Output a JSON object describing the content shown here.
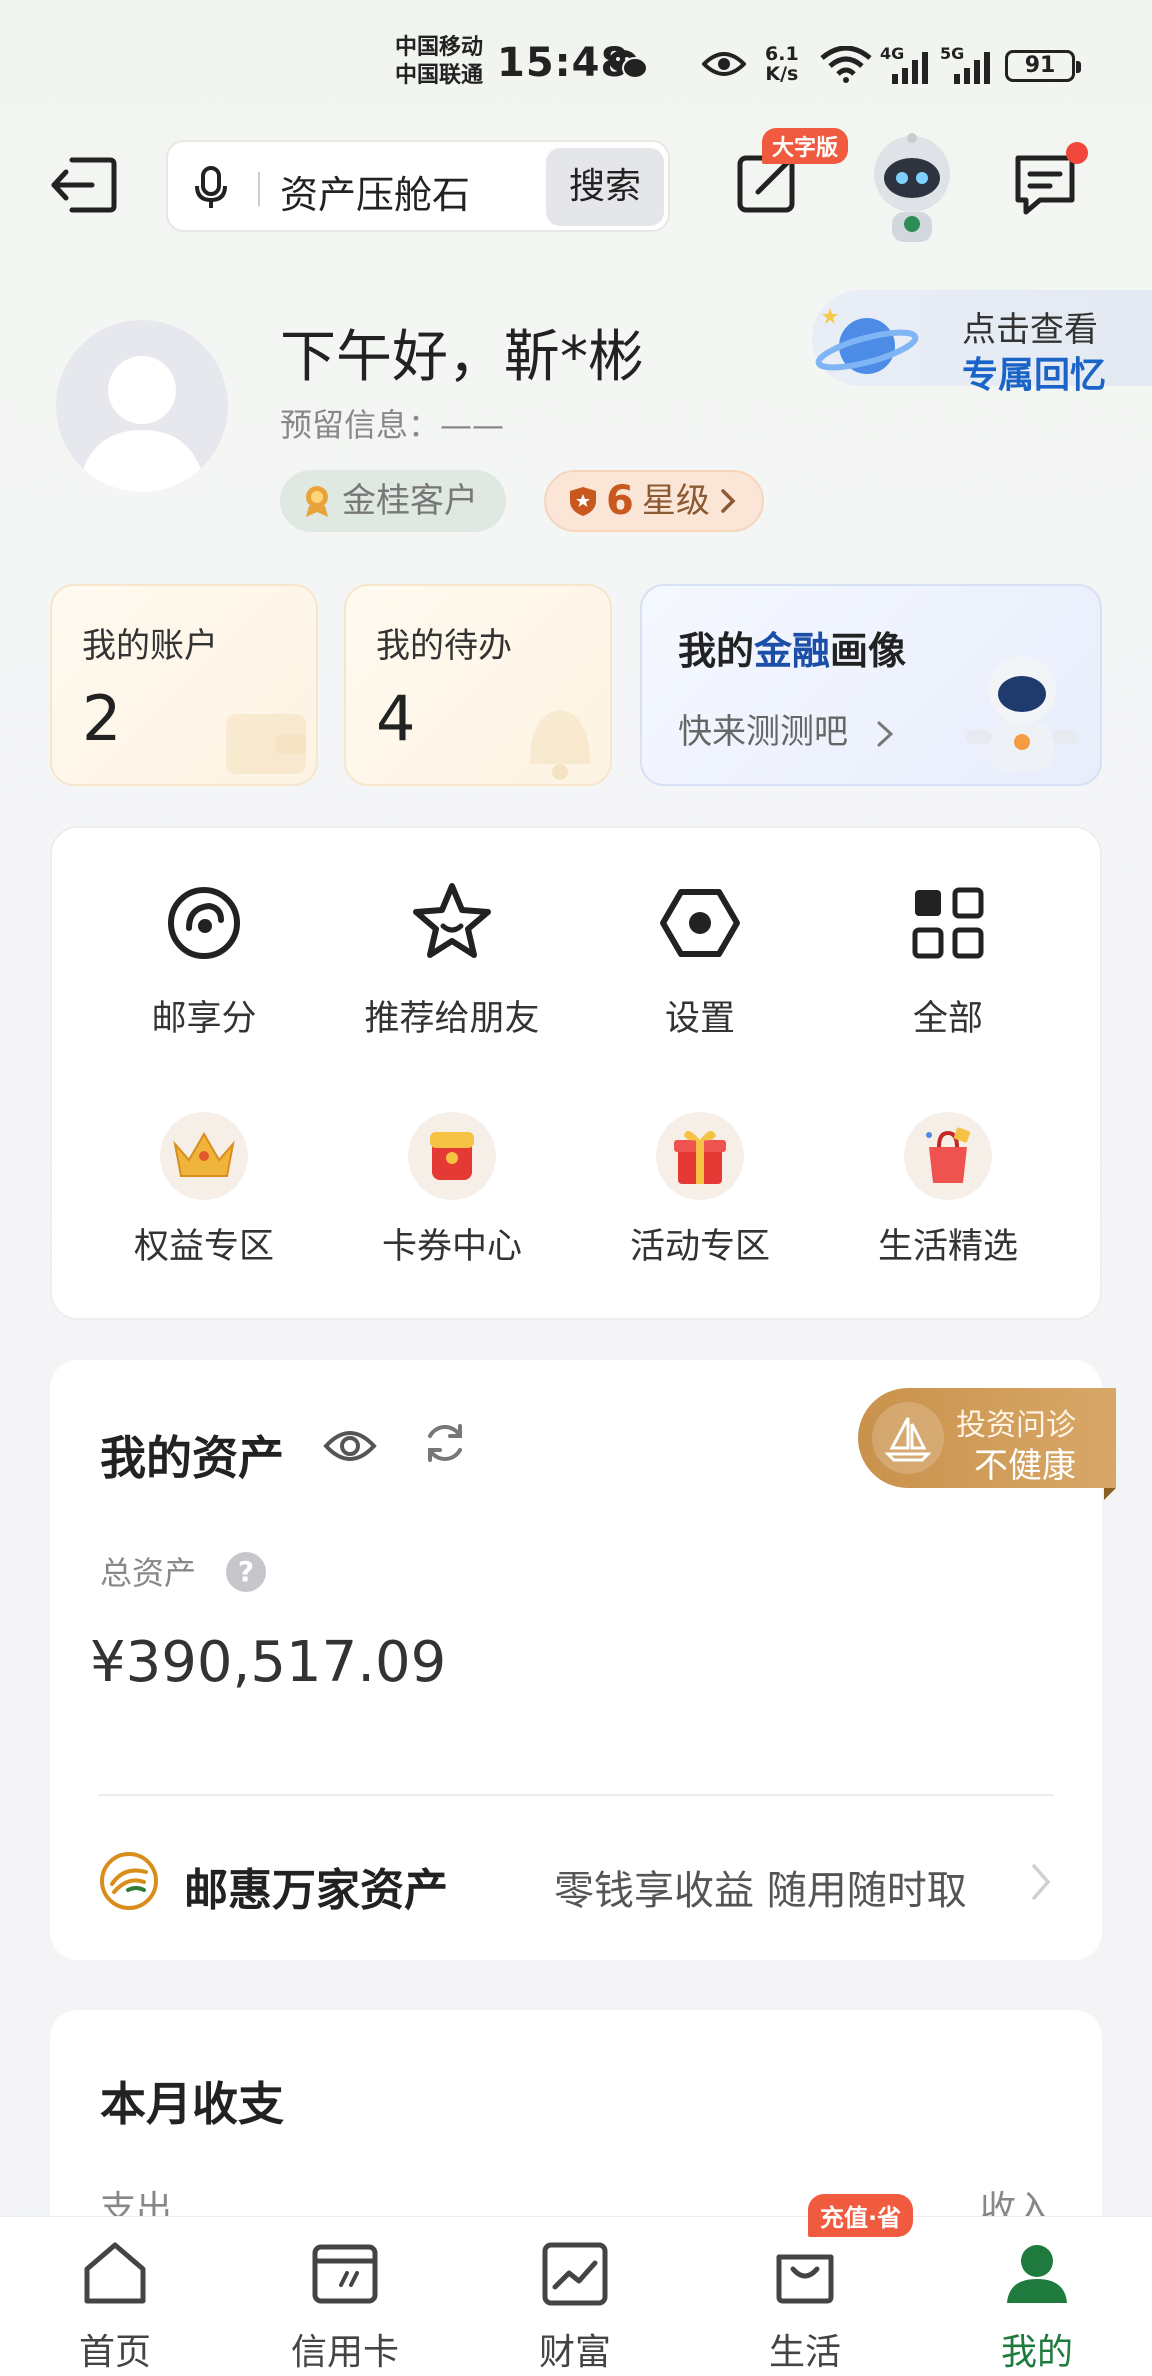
{
  "status_bar": {
    "carrier_1": "中国移动",
    "carrier_2": "中国联通",
    "time": "15:48",
    "net_speed_value": "6.1",
    "net_speed_unit": "K/s",
    "signal_1_label": "4G",
    "signal_2_label": "5G",
    "battery": "91"
  },
  "header": {
    "search_text": "资产压舱石",
    "search_button": "搜索",
    "big_font_badge": "大字版"
  },
  "profile": {
    "greeting": "下午好，靳*彬",
    "reserved_info": "预留信息：——",
    "tag_customer": "金桂客户",
    "tag_star_num": "6",
    "tag_star_text": "星级",
    "memory_top": "点击查看",
    "memory_bottom": "专属回忆"
  },
  "cards": {
    "account_label": "我的账户",
    "account_value": "2",
    "todo_label": "我的待办",
    "todo_value": "4",
    "portrait_title_a": "我的",
    "portrait_title_b": "金融",
    "portrait_title_c": "画像",
    "portrait_sub": "快来测测吧"
  },
  "shortcuts": [
    {
      "label": "邮享分",
      "icon": "target-icon"
    },
    {
      "label": "推荐给朋友",
      "icon": "star-smile-icon"
    },
    {
      "label": "设置",
      "icon": "hexagon-settings-icon"
    },
    {
      "label": "全部",
      "icon": "grid-icon"
    },
    {
      "label": "权益专区",
      "icon": "crown-icon"
    },
    {
      "label": "卡券中心",
      "icon": "red-envelope-icon"
    },
    {
      "label": "活动专区",
      "icon": "gift-icon"
    },
    {
      "label": "生活精选",
      "icon": "shopping-bag-icon"
    }
  ],
  "assets": {
    "title": "我的资产",
    "diagnosis_line1": "投资问诊",
    "diagnosis_line2": "不健康",
    "total_label": "总资产",
    "total_value": "¥390,517.09",
    "yh_title": "邮惠万家资产",
    "yh_subtitle": "零钱享收益 随用随时取"
  },
  "monthly": {
    "title": "本月收支",
    "expense_label": "支出",
    "income_label": "收入"
  },
  "bottom_nav": {
    "items": [
      "首页",
      "信用卡",
      "财富",
      "生活",
      "我的"
    ],
    "life_badge": "充值·省",
    "active": "我的",
    "active_color": "#1f7a3d"
  },
  "colors": {
    "accent_blue": "#1a64c8",
    "badge_red": "#f05a3e",
    "gold": "#c9924c"
  }
}
